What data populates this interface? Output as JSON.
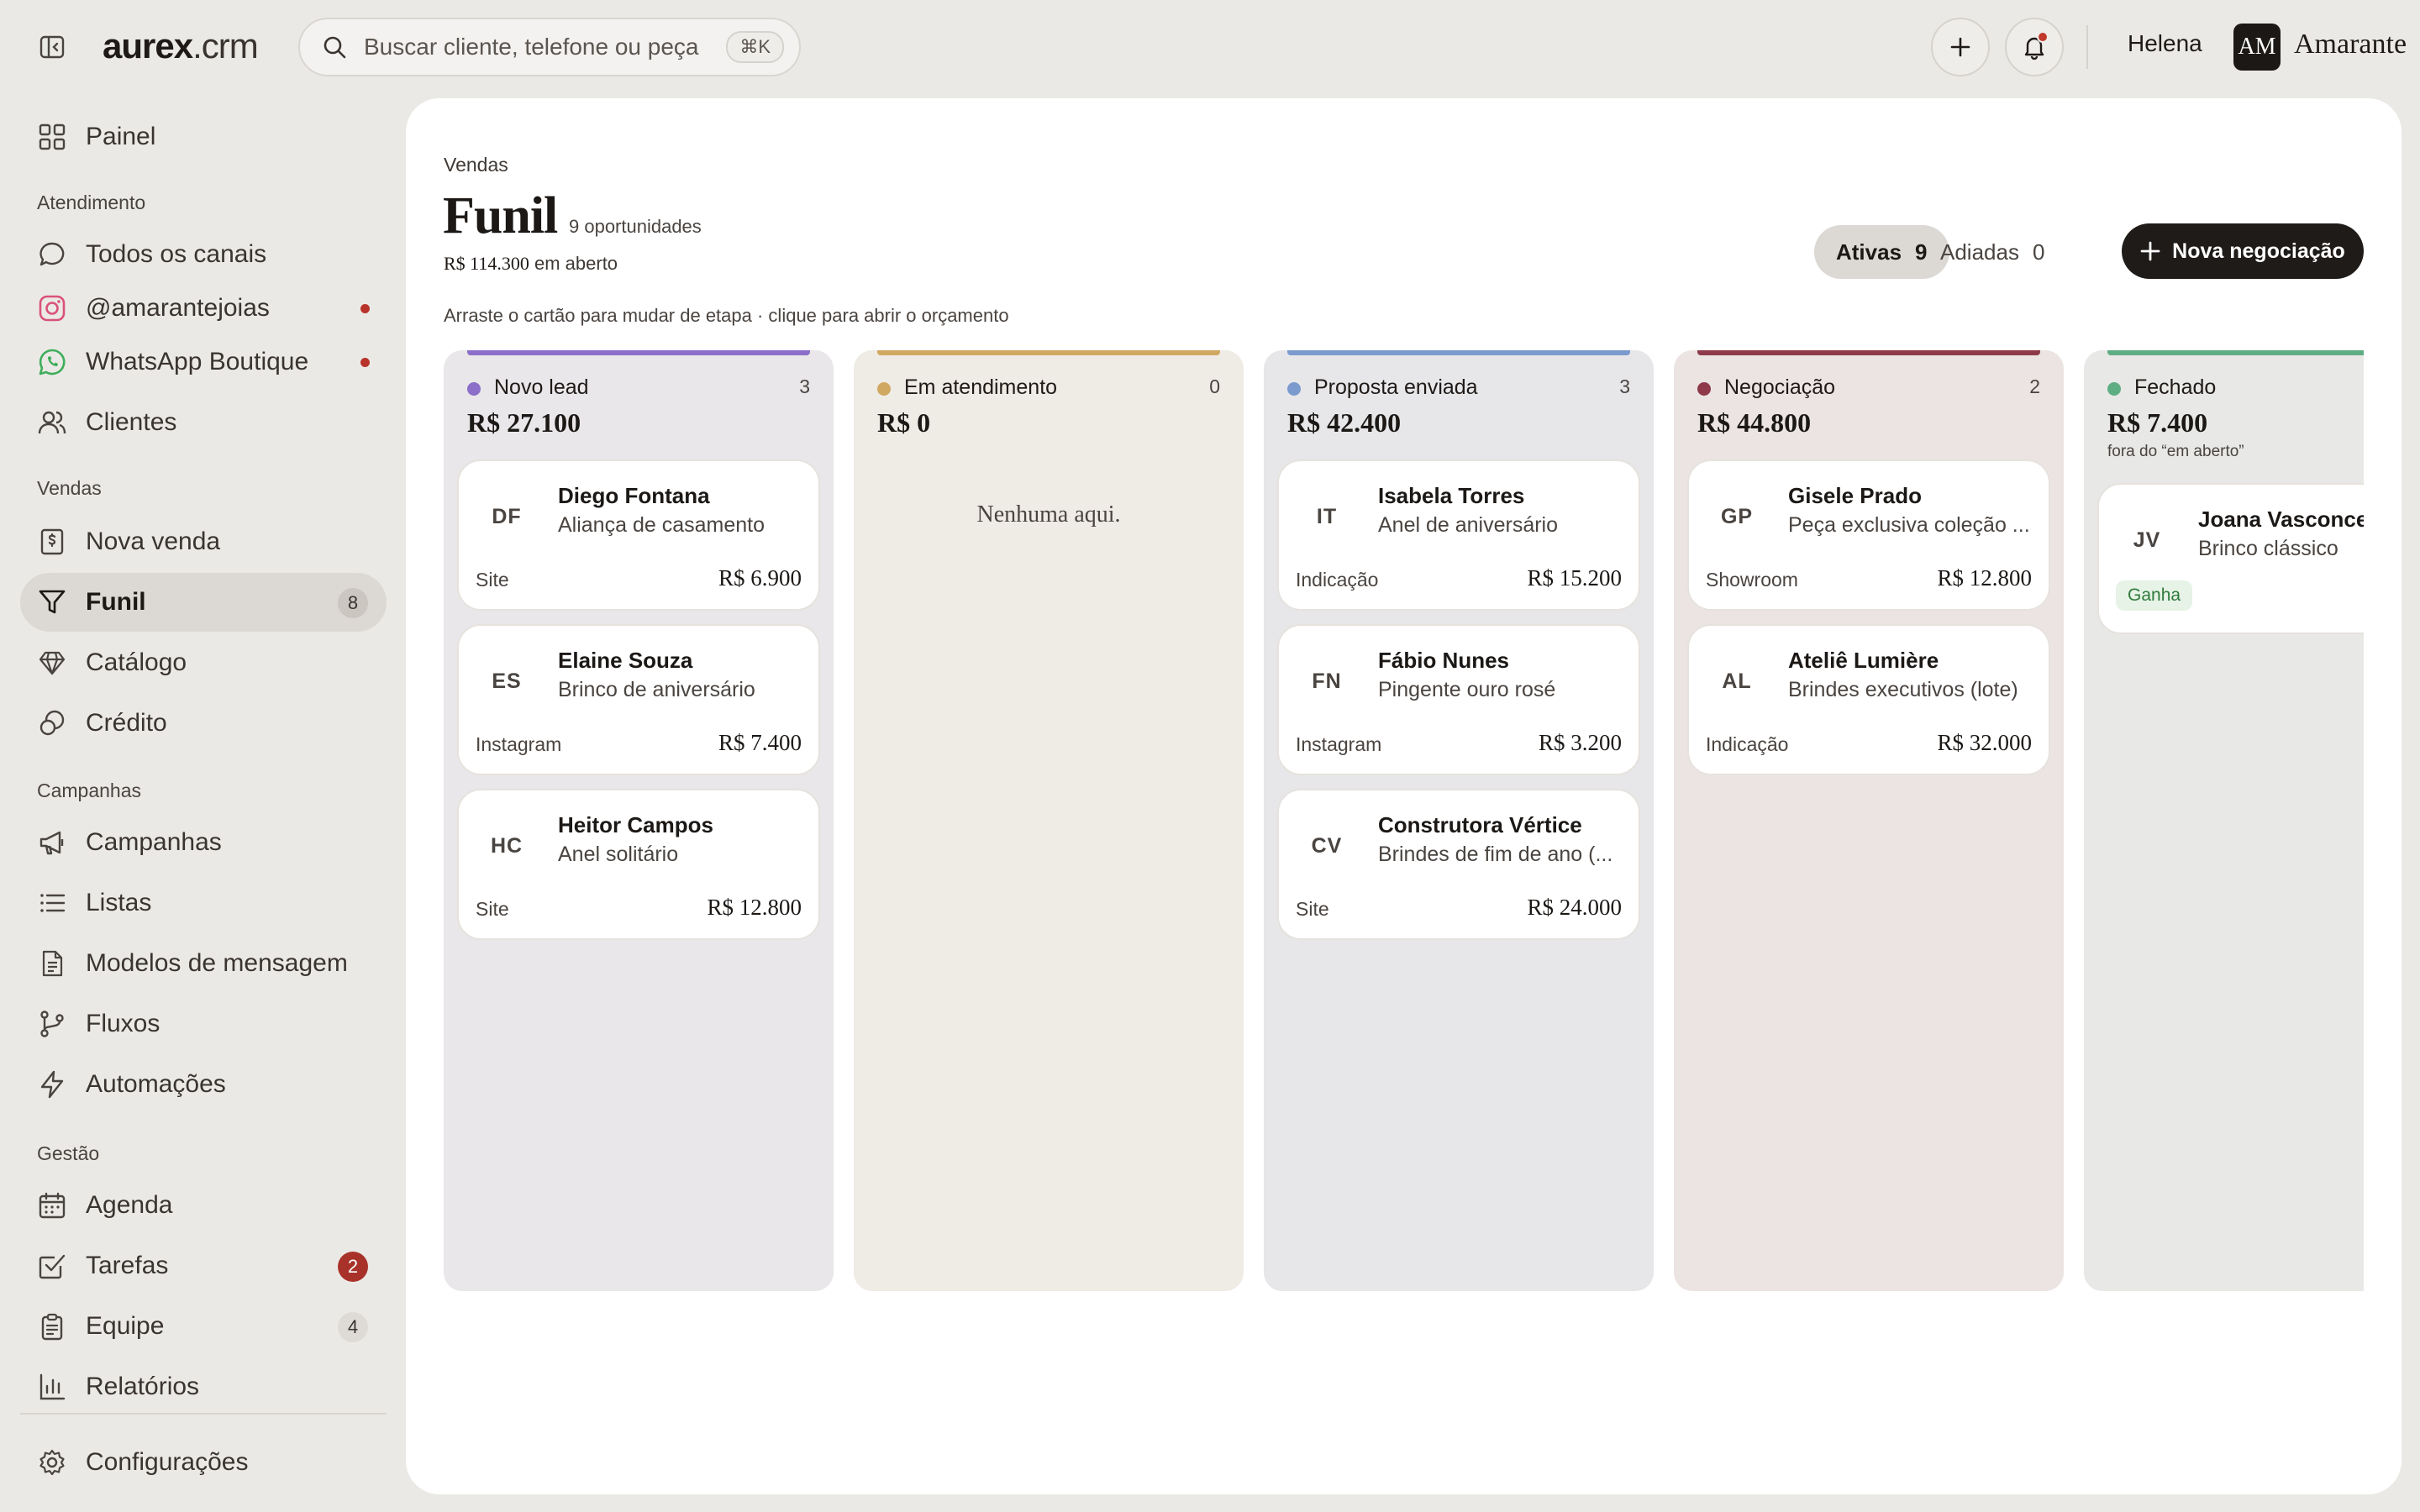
{
  "topbar": {
    "logo_bold": "aurex",
    "logo_rest": ".crm",
    "search_placeholder": "Buscar cliente, telefone ou peça",
    "search_shortcut": "⌘K",
    "user_name": "Helena",
    "brand_initials": "AM",
    "brand_name": "Amarante"
  },
  "sidebar": {
    "painel": "Painel",
    "section_atendimento": "Atendimento",
    "todos_canais": "Todos os canais",
    "instagram": "@amarantejoias",
    "whatsapp": "WhatsApp Boutique",
    "clientes": "Clientes",
    "section_vendas": "Vendas",
    "nova_venda": "Nova venda",
    "funil": "Funil",
    "funil_badge": "8",
    "catalogo": "Catálogo",
    "credito": "Crédito",
    "section_campanhas": "Campanhas",
    "campanhas": "Campanhas",
    "listas": "Listas",
    "modelos": "Modelos de mensagem",
    "fluxos": "Fluxos",
    "automacoes": "Automações",
    "section_gestao": "Gestão",
    "agenda": "Agenda",
    "tarefas": "Tarefas",
    "tarefas_badge": "2",
    "equipe": "Equipe",
    "equipe_badge": "4",
    "relatorios": "Relatórios",
    "configuracoes": "Configurações"
  },
  "main": {
    "breadcrumb": "Vendas",
    "title": "Funil",
    "opportunities": "9 oportunidades",
    "open_value": "R$ 114.300",
    "open_label": "em aberto",
    "hint": "Arraste o cartão para mudar de etapa · clique para abrir o orçamento",
    "filter_active_label": "Ativas",
    "filter_active_count": "9",
    "filter_postponed_label": "Adiadas",
    "filter_postponed_count": "0",
    "new_deal_button": "Nova negociação"
  },
  "columns": [
    {
      "name": "Novo lead",
      "count": "3",
      "total": "R$ 27.100",
      "color": "#8b6fc9",
      "bg": "#e9e7e9",
      "cards": [
        {
          "initials": "DF",
          "name": "Diego Fontana",
          "desc": "Aliança de casamento",
          "source": "Site",
          "value": "R$ 6.900"
        },
        {
          "initials": "ES",
          "name": "Elaine Souza",
          "desc": "Brinco de aniversário",
          "source": "Instagram",
          "value": "R$ 7.400"
        },
        {
          "initials": "HC",
          "name": "Heitor Campos",
          "desc": "Anel solitário",
          "source": "Site",
          "value": "R$ 12.800"
        }
      ]
    },
    {
      "name": "Em atendimento",
      "count": "0",
      "total": "R$ 0",
      "color": "#d1a862",
      "bg": "#efebe5",
      "empty": "Nenhuma aqui.",
      "cards": []
    },
    {
      "name": "Proposta enviada",
      "count": "3",
      "total": "R$ 42.400",
      "color": "#7b9bcf",
      "bg": "#e7e7e9",
      "cards": [
        {
          "initials": "IT",
          "name": "Isabela Torres",
          "desc": "Anel de aniversário",
          "source": "Indicação",
          "value": "R$ 15.200"
        },
        {
          "initials": "FN",
          "name": "Fábio Nunes",
          "desc": "Pingente ouro rosé",
          "source": "Instagram",
          "value": "R$ 3.200"
        },
        {
          "initials": "CV",
          "name": "Construtora Vértice",
          "desc": "Brindes de fim de ano (...",
          "source": "Site",
          "value": "R$ 24.000"
        }
      ]
    },
    {
      "name": "Negociação",
      "count": "2",
      "total": "R$ 44.800",
      "color": "#8e3a4a",
      "bg": "#ebe4e3",
      "cards": [
        {
          "initials": "GP",
          "name": "Gisele Prado",
          "desc": "Peça exclusiva coleção ...",
          "source": "Showroom",
          "value": "R$ 12.800"
        },
        {
          "initials": "AL",
          "name": "Ateliê Lumière",
          "desc": "Brindes executivos (lote)",
          "source": "Indicação",
          "value": "R$ 32.000"
        }
      ]
    },
    {
      "name": "Fechado",
      "count": "",
      "total": "R$ 7.400",
      "color": "#5fae83",
      "bg": "#e8e8e6",
      "note": "fora do “em aberto”",
      "cards": [
        {
          "initials": "JV",
          "name": "Joana Vasconcelos",
          "desc": "Brinco clássico",
          "tag": "Ganha"
        }
      ]
    }
  ]
}
